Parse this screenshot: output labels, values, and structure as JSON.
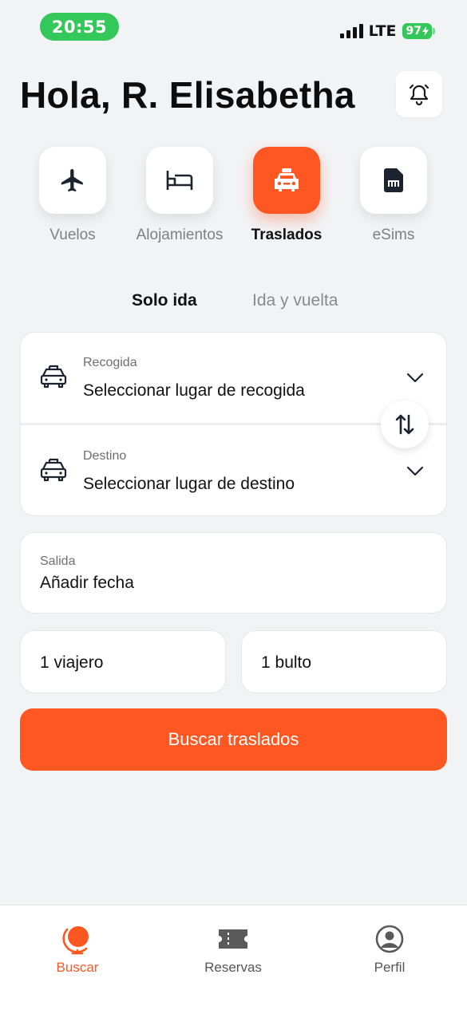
{
  "status_bar": {
    "time": "20:55",
    "network": "LTE",
    "battery": "97"
  },
  "header": {
    "greeting": "Hola, R. Elisabetha",
    "notification_icon": "bell-icon"
  },
  "categories": [
    {
      "label": "Vuelos",
      "icon": "plane-icon",
      "active": false
    },
    {
      "label": "Alojamientos",
      "icon": "bed-icon",
      "active": false
    },
    {
      "label": "Traslados",
      "icon": "taxi-icon",
      "active": true
    },
    {
      "label": "eSims",
      "icon": "sim-card-icon",
      "active": false
    }
  ],
  "trip_type": {
    "options": [
      "Solo ida",
      "Ida y vuelta"
    ],
    "selected": "Solo ida"
  },
  "route": {
    "pickup": {
      "label": "Recogida",
      "placeholder": "Seleccionar lugar de recogida",
      "icon": "taxi-icon"
    },
    "destination": {
      "label": "Destino",
      "placeholder": "Seleccionar lugar de destino",
      "icon": "taxi-icon"
    },
    "swap_icon": "swap-vertical-icon"
  },
  "departure": {
    "label": "Salida",
    "value": "Añadir fecha"
  },
  "travelers": "1 viajero",
  "luggage": "1 bulto",
  "search_button": "Buscar traslados",
  "bottom_nav": {
    "items": [
      {
        "label": "Buscar",
        "icon": "globe-icon",
        "active": true
      },
      {
        "label": "Reservas",
        "icon": "ticket-icon",
        "active": false
      },
      {
        "label": "Perfil",
        "icon": "profile-icon",
        "active": false
      }
    ]
  },
  "colors": {
    "accent": "#ff5722",
    "status_green": "#34c759",
    "background": "#f2f3f5",
    "card": "#ffffff",
    "text_primary": "#111111",
    "text_secondary": "#808080"
  }
}
